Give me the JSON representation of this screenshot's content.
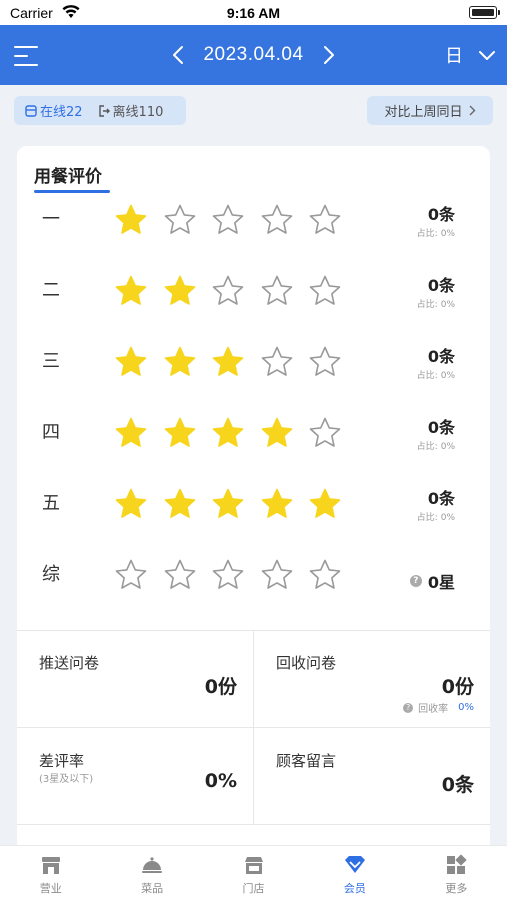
{
  "status_bar": {
    "carrier": "Carrier",
    "time": "9:16 AM"
  },
  "nav": {
    "date": "2023.04.04",
    "period": "日"
  },
  "chips": {
    "online": "在线22",
    "offline": "离线110",
    "compare": "对比上周同日"
  },
  "card": {
    "title": "用餐评价",
    "rows": [
      {
        "label": "一",
        "rating": 1,
        "count": "0条",
        "ratio_label": "占比:",
        "ratio": "0%"
      },
      {
        "label": "二",
        "rating": 2,
        "count": "0条",
        "ratio_label": "占比:",
        "ratio": "0%"
      },
      {
        "label": "三",
        "rating": 3,
        "count": "0条",
        "ratio_label": "占比:",
        "ratio": "0%"
      },
      {
        "label": "四",
        "rating": 4,
        "count": "0条",
        "ratio_label": "占比:",
        "ratio": "0%"
      },
      {
        "label": "五",
        "rating": 5,
        "count": "0条",
        "ratio_label": "占比:",
        "ratio": "0%"
      }
    ],
    "summary": {
      "label": "综",
      "rating": 0,
      "value": "0星"
    }
  },
  "stats": {
    "push": {
      "title": "推送问卷",
      "value": "0份"
    },
    "recover": {
      "title": "回收问卷",
      "value": "0份",
      "rate_label": "回收率",
      "rate": "0%"
    },
    "bad": {
      "title": "差评率",
      "sub": "(3星及以下)",
      "value": "0%"
    },
    "message": {
      "title": "顾客留言",
      "value": "0条"
    }
  },
  "tabs": [
    {
      "label": "营业",
      "icon": "store-icon"
    },
    {
      "label": "菜品",
      "icon": "dish-cloche-icon"
    },
    {
      "label": "门店",
      "icon": "shop-icon"
    },
    {
      "label": "会员",
      "icon": "member-diamond-icon"
    },
    {
      "label": "更多",
      "icon": "more-grid-icon"
    }
  ],
  "colors": {
    "primary": "#3675e0",
    "accent": "#2f6fe4",
    "star_filled": "#f7d51d",
    "star_empty": "#999999"
  }
}
